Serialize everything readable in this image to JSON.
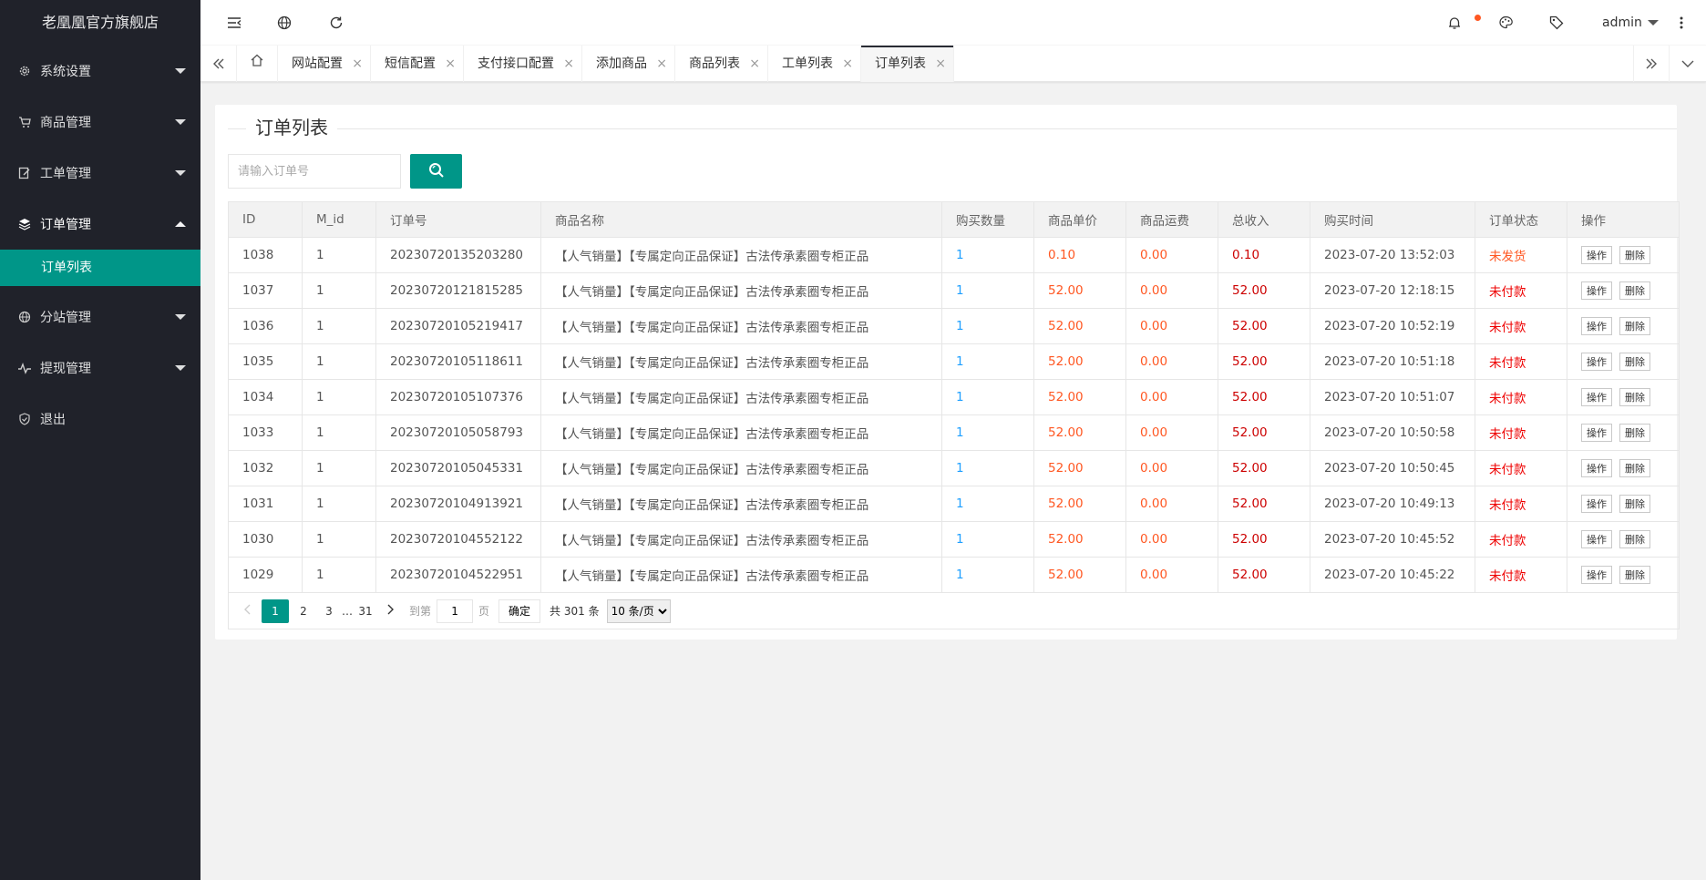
{
  "sidebar": {
    "logo": "老凰凰官方旗舰店",
    "items": [
      {
        "label": "系统设置"
      },
      {
        "label": "商品管理"
      },
      {
        "label": "工单管理"
      },
      {
        "label": "订单管理"
      },
      {
        "label": "分站管理"
      },
      {
        "label": "提现管理"
      },
      {
        "label": "退出"
      }
    ],
    "child_active": "订单列表"
  },
  "header": {
    "user": "admin"
  },
  "tabs": {
    "items": [
      "网站配置",
      "短信配置",
      "支付接口配置",
      "添加商品",
      "商品列表",
      "工单列表",
      "订单列表"
    ],
    "active": "订单列表",
    "close_icon": "×"
  },
  "page": {
    "title": "订单列表",
    "search_placeholder": "请输入订单号"
  },
  "table": {
    "columns": [
      "ID",
      "M_id",
      "订单号",
      "商品名称",
      "购买数量",
      "商品单价",
      "商品运费",
      "总收入",
      "购买时间",
      "订单状态",
      "操作"
    ],
    "rows": [
      {
        "id": "1038",
        "mid": "1",
        "order_no": "20230720135203280",
        "name": "【人气销量】【专属定向正品保证】古法传承素圈专柜正品",
        "qty": "1",
        "price": "0.10",
        "ship": "0.00",
        "total": "0.10",
        "time": "2023-07-20 13:52:03",
        "status": "未发货"
      },
      {
        "id": "1037",
        "mid": "1",
        "order_no": "20230720121815285",
        "name": "【人气销量】【专属定向正品保证】古法传承素圈专柜正品",
        "qty": "1",
        "price": "52.00",
        "ship": "0.00",
        "total": "52.00",
        "time": "2023-07-20 12:18:15",
        "status": "未付款"
      },
      {
        "id": "1036",
        "mid": "1",
        "order_no": "20230720105219417",
        "name": "【人气销量】【专属定向正品保证】古法传承素圈专柜正品",
        "qty": "1",
        "price": "52.00",
        "ship": "0.00",
        "total": "52.00",
        "time": "2023-07-20 10:52:19",
        "status": "未付款"
      },
      {
        "id": "1035",
        "mid": "1",
        "order_no": "20230720105118611",
        "name": "【人气销量】【专属定向正品保证】古法传承素圈专柜正品",
        "qty": "1",
        "price": "52.00",
        "ship": "0.00",
        "total": "52.00",
        "time": "2023-07-20 10:51:18",
        "status": "未付款"
      },
      {
        "id": "1034",
        "mid": "1",
        "order_no": "20230720105107376",
        "name": "【人气销量】【专属定向正品保证】古法传承素圈专柜正品",
        "qty": "1",
        "price": "52.00",
        "ship": "0.00",
        "total": "52.00",
        "time": "2023-07-20 10:51:07",
        "status": "未付款"
      },
      {
        "id": "1033",
        "mid": "1",
        "order_no": "20230720105058793",
        "name": "【人气销量】【专属定向正品保证】古法传承素圈专柜正品",
        "qty": "1",
        "price": "52.00",
        "ship": "0.00",
        "total": "52.00",
        "time": "2023-07-20 10:50:58",
        "status": "未付款"
      },
      {
        "id": "1032",
        "mid": "1",
        "order_no": "20230720105045331",
        "name": "【人气销量】【专属定向正品保证】古法传承素圈专柜正品",
        "qty": "1",
        "price": "52.00",
        "ship": "0.00",
        "total": "52.00",
        "time": "2023-07-20 10:50:45",
        "status": "未付款"
      },
      {
        "id": "1031",
        "mid": "1",
        "order_no": "20230720104913921",
        "name": "【人气销量】【专属定向正品保证】古法传承素圈专柜正品",
        "qty": "1",
        "price": "52.00",
        "ship": "0.00",
        "total": "52.00",
        "time": "2023-07-20 10:49:13",
        "status": "未付款"
      },
      {
        "id": "1030",
        "mid": "1",
        "order_no": "20230720104552122",
        "name": "【人气销量】【专属定向正品保证】古法传承素圈专柜正品",
        "qty": "1",
        "price": "52.00",
        "ship": "0.00",
        "total": "52.00",
        "time": "2023-07-20 10:45:52",
        "status": "未付款"
      },
      {
        "id": "1029",
        "mid": "1",
        "order_no": "20230720104522951",
        "name": "【人气销量】【专属定向正品保证】古法传承素圈专柜正品",
        "qty": "1",
        "price": "52.00",
        "ship": "0.00",
        "total": "52.00",
        "time": "2023-07-20 10:45:22",
        "status": "未付款"
      }
    ],
    "op_label": "操作",
    "delete_label": "删除"
  },
  "pager": {
    "pages": [
      "1",
      "2",
      "3",
      "…",
      "31"
    ],
    "current": "1",
    "goto_label": "到第",
    "goto_value": "1",
    "page_unit": "页",
    "confirm": "确定",
    "total": "共 301 条",
    "page_size": "10 条/页"
  },
  "colors": {
    "accent": "#009688",
    "sidebar_bg": "#20222a",
    "price": "#ff5722",
    "total": "#cc0000",
    "qty": "#1e9fff"
  }
}
